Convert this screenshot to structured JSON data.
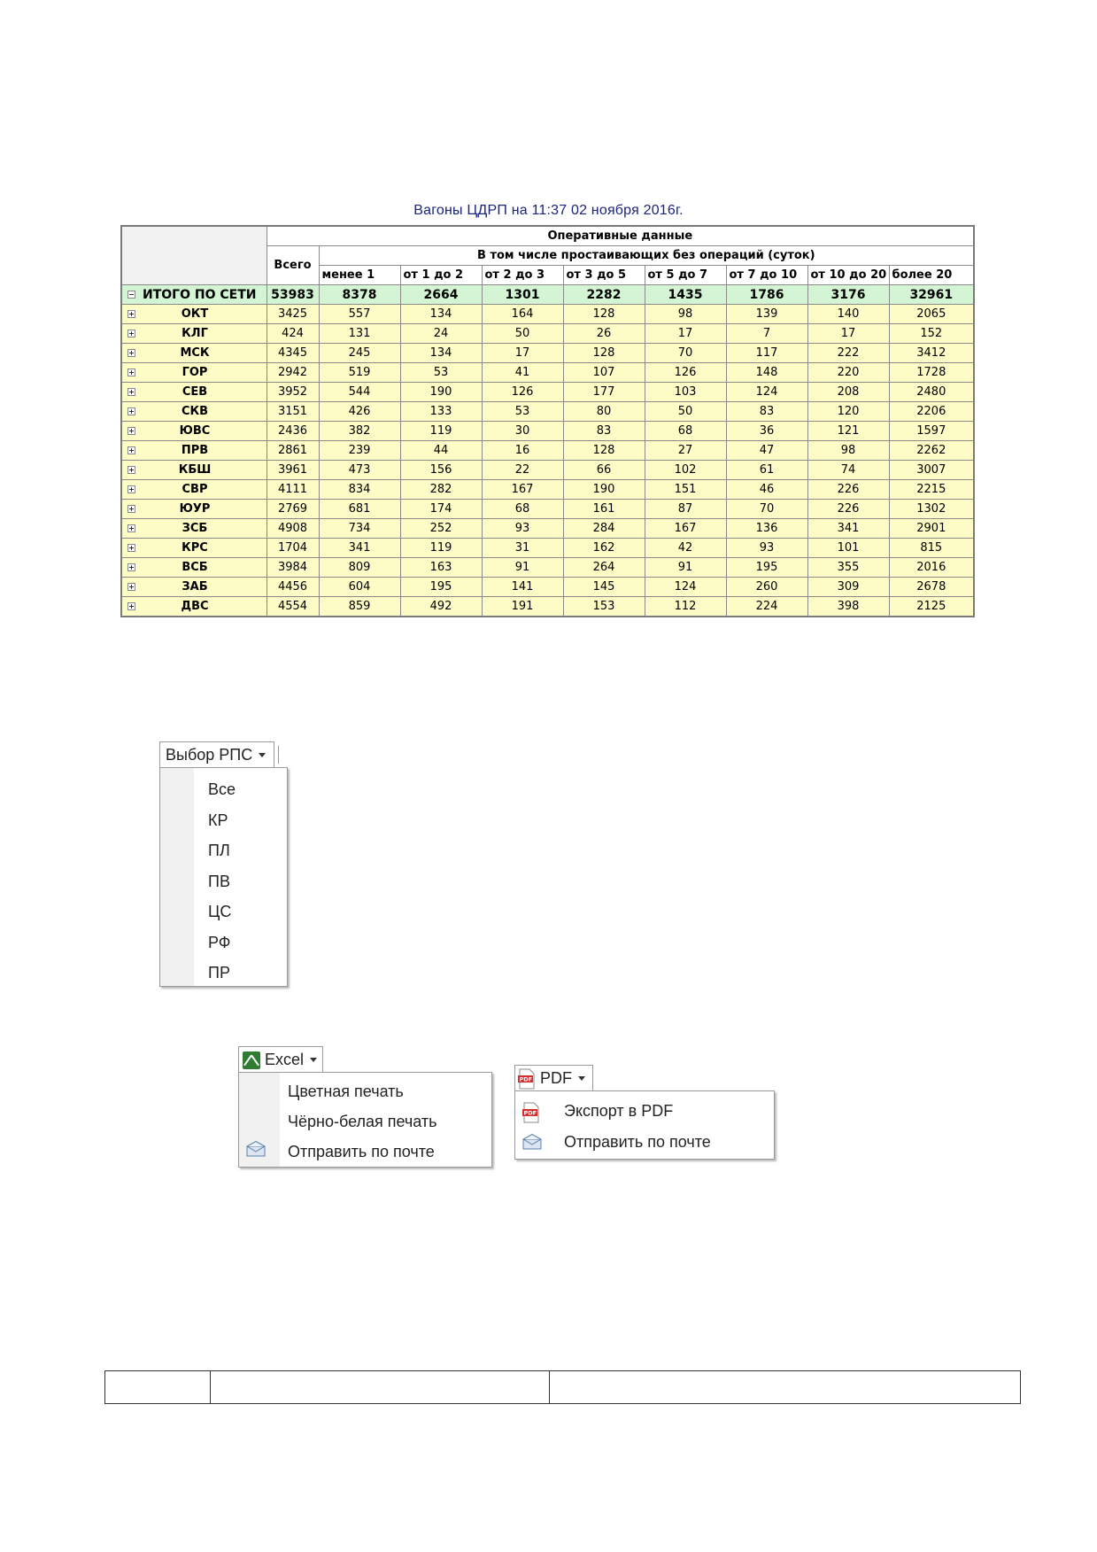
{
  "report": {
    "title": "Вагоны ЦДРП на   11:37 02 ноября 2016г.",
    "header": {
      "group_label": "Оперативные данные",
      "total_label": "Всего",
      "sub_group_label": "В том числе простаивающих без операций (суток)",
      "columns": [
        "менее 1",
        "от 1 до 2",
        "от 2 до 3",
        "от 3 до 5",
        "от 5 до 7",
        "от 7 до 10",
        "от 10 до 20",
        "более 20"
      ]
    },
    "total_row": {
      "label": "ИТОГО ПО СЕТИ",
      "values": [
        "53983",
        "8378",
        "2664",
        "1301",
        "2282",
        "1435",
        "1786",
        "3176",
        "32961"
      ]
    },
    "rows": [
      {
        "label": "ОКТ",
        "values": [
          "3425",
          "557",
          "134",
          "164",
          "128",
          "98",
          "139",
          "140",
          "2065"
        ]
      },
      {
        "label": "КЛГ",
        "values": [
          "424",
          "131",
          "24",
          "50",
          "26",
          "17",
          "7",
          "17",
          "152"
        ]
      },
      {
        "label": "МСК",
        "values": [
          "4345",
          "245",
          "134",
          "17",
          "128",
          "70",
          "117",
          "222",
          "3412"
        ]
      },
      {
        "label": "ГОР",
        "values": [
          "2942",
          "519",
          "53",
          "41",
          "107",
          "126",
          "148",
          "220",
          "1728"
        ]
      },
      {
        "label": "СЕВ",
        "values": [
          "3952",
          "544",
          "190",
          "126",
          "177",
          "103",
          "124",
          "208",
          "2480"
        ]
      },
      {
        "label": "СКВ",
        "values": [
          "3151",
          "426",
          "133",
          "53",
          "80",
          "50",
          "83",
          "120",
          "2206"
        ]
      },
      {
        "label": "ЮВС",
        "values": [
          "2436",
          "382",
          "119",
          "30",
          "83",
          "68",
          "36",
          "121",
          "1597"
        ]
      },
      {
        "label": "ПРВ",
        "values": [
          "2861",
          "239",
          "44",
          "16",
          "128",
          "27",
          "47",
          "98",
          "2262"
        ]
      },
      {
        "label": "КБШ",
        "values": [
          "3961",
          "473",
          "156",
          "22",
          "66",
          "102",
          "61",
          "74",
          "3007"
        ]
      },
      {
        "label": "СВР",
        "values": [
          "4111",
          "834",
          "282",
          "167",
          "190",
          "151",
          "46",
          "226",
          "2215"
        ]
      },
      {
        "label": "ЮУР",
        "values": [
          "2769",
          "681",
          "174",
          "68",
          "161",
          "87",
          "70",
          "226",
          "1302"
        ]
      },
      {
        "label": "ЗСБ",
        "values": [
          "4908",
          "734",
          "252",
          "93",
          "284",
          "167",
          "136",
          "341",
          "2901"
        ]
      },
      {
        "label": "КРС",
        "values": [
          "1704",
          "341",
          "119",
          "31",
          "162",
          "42",
          "93",
          "101",
          "815"
        ]
      },
      {
        "label": "ВСБ",
        "values": [
          "3984",
          "809",
          "163",
          "91",
          "264",
          "91",
          "195",
          "355",
          "2016"
        ]
      },
      {
        "label": "ЗАБ",
        "values": [
          "4456",
          "604",
          "195",
          "141",
          "145",
          "124",
          "260",
          "309",
          "2678"
        ]
      },
      {
        "label": "ДВС",
        "values": [
          "4554",
          "859",
          "492",
          "191",
          "153",
          "112",
          "224",
          "398",
          "2125"
        ]
      }
    ]
  },
  "rps_menu": {
    "button_label": "Выбор РПС",
    "items": [
      "Все",
      "КР",
      "ПЛ",
      "ПВ",
      "ЦС",
      "РФ",
      "ПР"
    ]
  },
  "excel_menu": {
    "button_label": "Excel",
    "items": [
      "Цветная печать",
      "Чёрно-белая печать",
      "Отправить по почте"
    ]
  },
  "pdf_menu": {
    "button_label": "PDF",
    "items": [
      "Экспорт в PDF",
      "Отправить по почте"
    ]
  },
  "colors": {
    "title": "#1a237e",
    "total_row_bg": "#d4f5d4",
    "row_bg": "#fdfbc6",
    "excel_green": "#2e7d32",
    "pdf_red": "#d32f2f"
  }
}
